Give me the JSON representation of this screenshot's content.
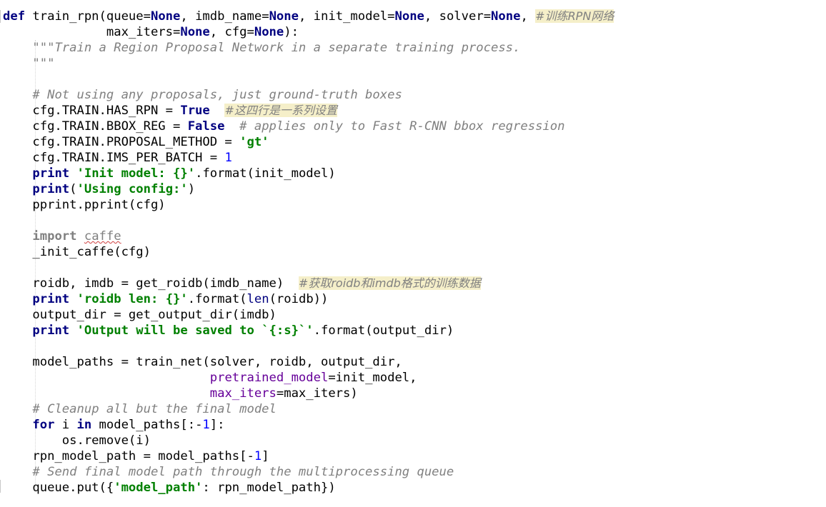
{
  "code_lines": [
    [
      {
        "t": "def",
        "c": "kw"
      },
      {
        "t": " train_rpn(queue="
      },
      {
        "t": "None",
        "c": "kw"
      },
      {
        "t": ", imdb_name="
      },
      {
        "t": "None",
        "c": "kw"
      },
      {
        "t": ", init_model="
      },
      {
        "t": "None",
        "c": "kw"
      },
      {
        "t": ", solver="
      },
      {
        "t": "None",
        "c": "kw"
      },
      {
        "t": ", "
      },
      {
        "t": "#训练RPN网络",
        "c": "cn"
      }
    ],
    [
      {
        "t": "              max_iters="
      },
      {
        "t": "None",
        "c": "kw"
      },
      {
        "t": ", cfg="
      },
      {
        "t": "None",
        "c": "kw"
      },
      {
        "t": "):"
      }
    ],
    [
      {
        "t": "    "
      },
      {
        "t": "\"\"\"Train a Region Proposal Network in a separate training process.",
        "c": "doc"
      }
    ],
    [
      {
        "t": "    "
      },
      {
        "t": "\"\"\"",
        "c": "doc"
      }
    ],
    [
      {
        "t": ""
      }
    ],
    [
      {
        "t": "    "
      },
      {
        "t": "# Not using any proposals, just ground-truth boxes",
        "c": "cmt"
      }
    ],
    [
      {
        "t": "    cfg.TRAIN.HAS_RPN = "
      },
      {
        "t": "True",
        "c": "kw"
      },
      {
        "t": "  "
      },
      {
        "t": "#这四行是一系列设置",
        "c": "cn"
      }
    ],
    [
      {
        "t": "    cfg.TRAIN.BBOX_REG = "
      },
      {
        "t": "False",
        "c": "kw"
      },
      {
        "t": "  "
      },
      {
        "t": "# applies only to Fast R-CNN bbox regression",
        "c": "cmt"
      }
    ],
    [
      {
        "t": "    cfg.TRAIN.PROPOSAL_METHOD = "
      },
      {
        "t": "'gt'",
        "c": "str"
      }
    ],
    [
      {
        "t": "    cfg.TRAIN.IMS_PER_BATCH = "
      },
      {
        "t": "1",
        "c": "num"
      }
    ],
    [
      {
        "t": "    "
      },
      {
        "t": "print",
        "c": "kw"
      },
      {
        "t": " "
      },
      {
        "t": "'Init model: {}'",
        "c": "str"
      },
      {
        "t": ".format(init_model)"
      }
    ],
    [
      {
        "t": "    "
      },
      {
        "t": "print",
        "c": "kw"
      },
      {
        "t": "("
      },
      {
        "t": "'Using config:'",
        "c": "str"
      },
      {
        "t": ")"
      }
    ],
    [
      {
        "t": "    pprint.pprint(cfg)"
      }
    ],
    [
      {
        "t": ""
      }
    ],
    [
      {
        "t": "    "
      },
      {
        "t": "import",
        "c": "imp"
      },
      {
        "t": " "
      },
      {
        "t": "caffe",
        "c": "unused"
      }
    ],
    [
      {
        "t": "    _init_caffe(cfg)"
      }
    ],
    [
      {
        "t": ""
      }
    ],
    [
      {
        "t": "    roidb, imdb = get_roidb(imdb_name)  "
      },
      {
        "t": "#获取roidb和imdb格式的训练数据",
        "c": "cn"
      }
    ],
    [
      {
        "t": "    "
      },
      {
        "t": "print",
        "c": "kw"
      },
      {
        "t": " "
      },
      {
        "t": "'roidb len: {}'",
        "c": "str"
      },
      {
        "t": ".format("
      },
      {
        "t": "len",
        "c": "builtin"
      },
      {
        "t": "(roidb))"
      }
    ],
    [
      {
        "t": "    output_dir = get_output_dir(imdb)"
      }
    ],
    [
      {
        "t": "    "
      },
      {
        "t": "print",
        "c": "kw"
      },
      {
        "t": " "
      },
      {
        "t": "'Output will be saved to `{:s}`'",
        "c": "str"
      },
      {
        "t": ".format(output_dir)"
      }
    ],
    [
      {
        "t": ""
      }
    ],
    [
      {
        "t": "    model_paths = train_net(solver, roidb, output_dir,"
      }
    ],
    [
      {
        "t": "                            "
      },
      {
        "t": "pretrained_model",
        "c": "kwarg"
      },
      {
        "t": "=init_model,"
      }
    ],
    [
      {
        "t": "                            "
      },
      {
        "t": "max_iters",
        "c": "kwarg"
      },
      {
        "t": "=max_iters)"
      }
    ],
    [
      {
        "t": "    "
      },
      {
        "t": "# Cleanup all but the final model",
        "c": "cmt"
      }
    ],
    [
      {
        "t": "    "
      },
      {
        "t": "for",
        "c": "kw"
      },
      {
        "t": " i "
      },
      {
        "t": "in",
        "c": "kw"
      },
      {
        "t": " model_paths[:-"
      },
      {
        "t": "1",
        "c": "num"
      },
      {
        "t": "]:"
      }
    ],
    [
      {
        "t": "        os.remove(i)"
      }
    ],
    [
      {
        "t": "    rpn_model_path = model_paths[-"
      },
      {
        "t": "1",
        "c": "num"
      },
      {
        "t": "]"
      }
    ],
    [
      {
        "t": "    "
      },
      {
        "t": "# Send final model path through the multiprocessing queue",
        "c": "cmt"
      }
    ],
    [
      {
        "t": "    queue.put({"
      },
      {
        "t": "'model_path'",
        "c": "str"
      },
      {
        "t": ": rpn_model_path})"
      }
    ]
  ]
}
